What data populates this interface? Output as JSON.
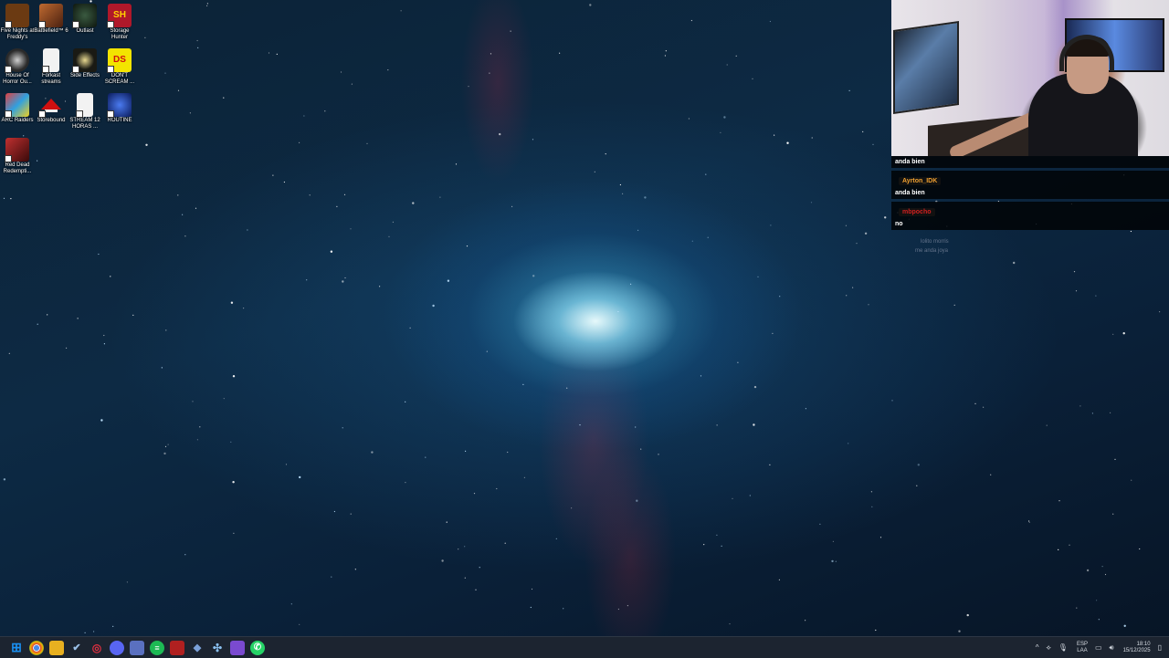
{
  "desktop": {
    "icons": [
      {
        "label": "Five Nights at Freddy's",
        "icon": "fnaf-icon",
        "color": "#6b3a12"
      },
      {
        "label": "Battlefield™ 6",
        "icon": "battlefield-icon",
        "color": "#7a3a20"
      },
      {
        "label": "Outlast",
        "icon": "outlast-icon",
        "color": "#1c2a20"
      },
      {
        "label": "Storage Hunter",
        "icon": "storage-hunter-icon",
        "color": "#b0182a"
      },
      {
        "label": "House Of Horror Ou...",
        "icon": "house-of-horror-icon",
        "color": "#2a2a2a"
      },
      {
        "label": "Forkast streams",
        "icon": "document-icon",
        "color": "#f2f2f2"
      },
      {
        "label": "Side Effects",
        "icon": "side-effects-icon",
        "color": "#1a1a14"
      },
      {
        "label": "DON'T SCREAM ...",
        "icon": "dont-scream-icon",
        "color": "#f3e400"
      },
      {
        "label": "ARC Raiders",
        "icon": "arc-raiders-icon",
        "color": "#c92a2a"
      },
      {
        "label": "Storebound",
        "icon": "storebound-icon",
        "color": "#d01010"
      },
      {
        "label": "STREAM 12 HORAS ...",
        "icon": "document-icon",
        "color": "#f2f2f2"
      },
      {
        "label": "ROUTINE",
        "icon": "routine-icon",
        "color": "#1a3a9a"
      },
      {
        "label": "Red Dead Redempti...",
        "icon": "red-dead-icon",
        "color": "#8a1c1c"
      }
    ],
    "glyphs": {
      "storage_hunter": "SH",
      "dont_scream": "DS"
    }
  },
  "chat": {
    "messages": [
      {
        "user": "",
        "text": "anda bien"
      },
      {
        "user": "Ayrton_IDK",
        "text": "anda bien",
        "user_color": "#f0a030"
      },
      {
        "user": "mbpocho",
        "text": "no",
        "user_color": "#d02020"
      }
    ],
    "faded": [
      {
        "user": "lolito morris",
        "text": "me anda joya"
      }
    ]
  },
  "taskbar": {
    "apps": [
      {
        "name": "start-button",
        "color": "#1a8ff0",
        "glyph": "⊞"
      },
      {
        "name": "chrome-icon",
        "color": "#2a8a3a",
        "glyph": "◉"
      },
      {
        "name": "file-explorer-icon",
        "color": "#e8b020",
        "glyph": "▭"
      },
      {
        "name": "steam-icon",
        "color": "#2a4060",
        "glyph": "✔"
      },
      {
        "name": "opera-icon",
        "color": "#c02030",
        "glyph": "◎"
      },
      {
        "name": "discord-icon",
        "color": "#5865f2",
        "glyph": "◕"
      },
      {
        "name": "chat-app-icon",
        "color": "#5a70c0",
        "glyph": "▢"
      },
      {
        "name": "spotify-icon",
        "color": "#1db954",
        "glyph": "≡"
      },
      {
        "name": "news-app-icon",
        "color": "#b02020",
        "glyph": "▤"
      },
      {
        "name": "network-app-icon",
        "color": "#4a6aa0",
        "glyph": "◆"
      },
      {
        "name": "ubisoft-icon",
        "color": "#4a90d0",
        "glyph": "✣"
      },
      {
        "name": "twitch-icon",
        "color": "#7a4ad0",
        "glyph": "▣"
      },
      {
        "name": "whatsapp-icon",
        "color": "#25d366",
        "glyph": "✆"
      }
    ],
    "tray": {
      "chevron": "^",
      "lang_line1": "ESP",
      "lang_line2": "LAA",
      "time": "18:10",
      "date": "15/12/2025"
    }
  }
}
